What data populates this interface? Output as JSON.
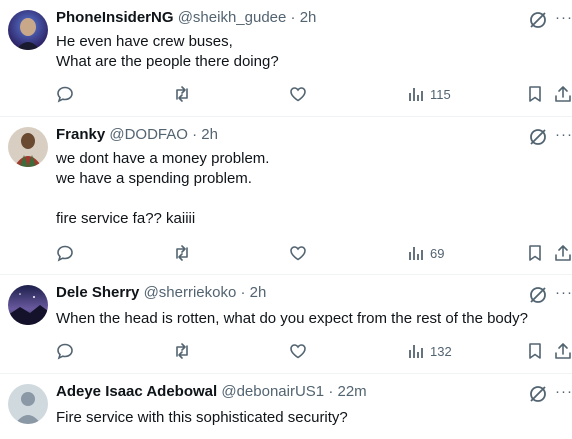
{
  "tweets": [
    {
      "name": "PhoneInsiderNG",
      "handle": "@sheikh_gudee",
      "time": "2h",
      "lines": [
        "He even have crew buses,",
        "What are the people there doing?"
      ],
      "views": "115"
    },
    {
      "name": "Franky",
      "handle": "@DODFAO",
      "time": "2h",
      "lines": [
        "we dont have a money problem.",
        "we have a spending problem.",
        "",
        "fire service fa?? kaiiii"
      ],
      "views": "69"
    },
    {
      "name": "Dele Sherry",
      "handle": "@sherriekoko",
      "time": "2h",
      "lines": [
        "When the head is rotten, what do you expect from the rest of the body?"
      ],
      "views": "132"
    },
    {
      "name": "Adeye Isaac Adebowal",
      "handle": "@debonairUS1",
      "time": "22m",
      "lines": [
        "Fire service with this sophisticated security?"
      ],
      "views": ""
    }
  ],
  "separator": "·",
  "more_label": "···",
  "colors": {
    "text": "#0f1419",
    "secondary": "#536471",
    "divider": "#eff3f4"
  },
  "icons": [
    "grok-icon",
    "more-icon",
    "reply-icon",
    "retweet-icon",
    "like-icon",
    "views-icon",
    "bookmark-icon",
    "share-icon"
  ]
}
